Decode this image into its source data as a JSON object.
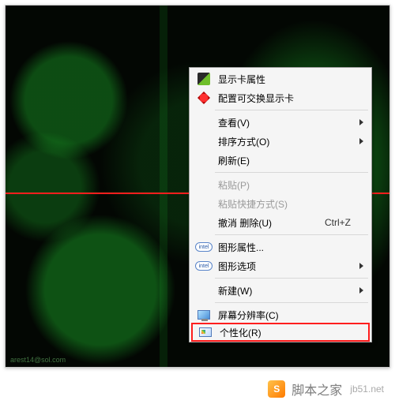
{
  "wallpaper_tag": "arest14@sol.com",
  "menu": {
    "display_card_props": "显示卡属性",
    "switchable_graphics": "配置可交换显示卡",
    "view": "查看(V)",
    "sort": "排序方式(O)",
    "refresh": "刷新(E)",
    "paste": "粘贴(P)",
    "paste_shortcut": "粘贴快捷方式(S)",
    "undo_delete": "撤消 删除(U)",
    "undo_delete_key": "Ctrl+Z",
    "graphics_props": "图形属性...",
    "graphics_options": "图形选项",
    "new": "新建(W)",
    "screen_res": "屏幕分辨率(C)",
    "personalize": "个性化(R)"
  },
  "intel_badge": "intel",
  "watermark": {
    "name": "脚本之家",
    "site": "jb51.net",
    "logo": "S"
  }
}
